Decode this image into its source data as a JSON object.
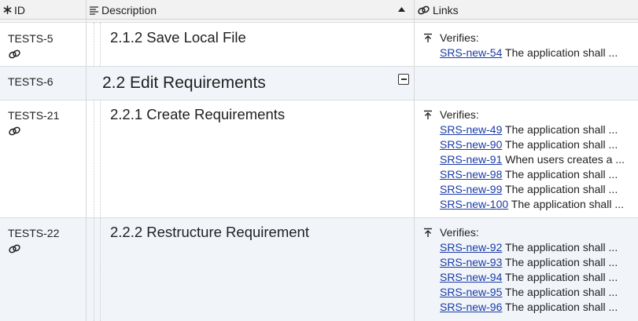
{
  "header": {
    "id_label": "ID",
    "description_label": "Description",
    "links_label": "Links"
  },
  "rows": [
    {
      "id": "TESTS-5",
      "description": "2.1.2 Save Local File",
      "verifies_label": "Verifies:",
      "links": [
        {
          "key": "SRS-new-54",
          "text": "The application shall ..."
        }
      ]
    },
    {
      "id": "TESTS-6",
      "description": "2.2 Edit Requirements"
    },
    {
      "id": "TESTS-21",
      "description": "2.2.1 Create Requirements",
      "verifies_label": "Verifies:",
      "links": [
        {
          "key": "SRS-new-49",
          "text": "The application shall ..."
        },
        {
          "key": "SRS-new-90",
          "text": "The application shall ..."
        },
        {
          "key": "SRS-new-91",
          "text": "When users creates a ..."
        },
        {
          "key": "SRS-new-98",
          "text": "The application shall ..."
        },
        {
          "key": "SRS-new-99",
          "text": "The application shall ..."
        },
        {
          "key": "SRS-new-100",
          "text": "The application shall ..."
        }
      ]
    },
    {
      "id": "TESTS-22",
      "description": "2.2.2 Restructure Requirement",
      "verifies_label": "Verifies:",
      "links": [
        {
          "key": "SRS-new-92",
          "text": "The application shall ..."
        },
        {
          "key": "SRS-new-93",
          "text": "The application shall ..."
        },
        {
          "key": "SRS-new-94",
          "text": "The application shall ..."
        },
        {
          "key": "SRS-new-95",
          "text": "The application shall ..."
        },
        {
          "key": "SRS-new-96",
          "text": "The application shall ..."
        }
      ]
    }
  ],
  "icons": {
    "id_column": "asterisk-icon",
    "description_column": "text-align-icon",
    "links_column": "link-icon",
    "sort": "sort-ascending-icon",
    "verifies": "upload-arrow-icon",
    "collapse": "collapse-icon"
  },
  "colors": {
    "link": "#1a3ba6",
    "row_alt": "#f1f5fa",
    "header_bg": "#f2f2f2"
  }
}
